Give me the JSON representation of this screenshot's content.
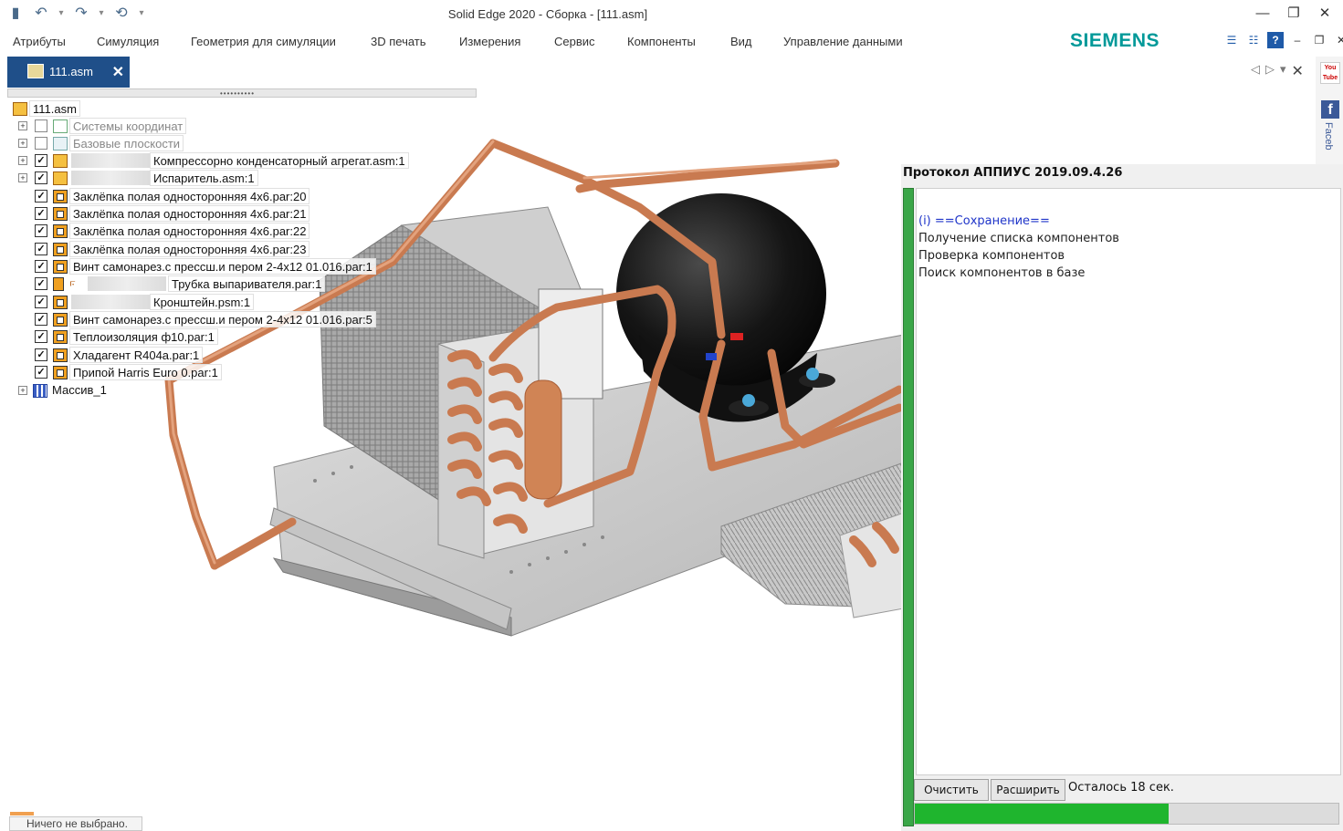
{
  "window": {
    "title": "Solid Edge 2020 - Сборка - [111.asm]",
    "brand": "SIEMENS"
  },
  "menu": [
    "Атрибуты",
    "Симуляция",
    "Геометрия для симуляции",
    "3D печать",
    "Измерения",
    "Сервис",
    "Компоненты",
    "Вид",
    "Управление данными"
  ],
  "doc_tab": {
    "label": "111.asm"
  },
  "tree": {
    "root": "111.asm",
    "items": [
      {
        "label": "Системы координат",
        "icon": "coordinate-system-icon"
      },
      {
        "label": "Базовые плоскости",
        "icon": "reference-plane-icon"
      },
      {
        "label": "Компрессорно конденсаторный агрегат.asm:1",
        "icon": "assembly-icon"
      },
      {
        "label": "Испаритель.asm:1",
        "icon": "assembly-icon"
      },
      {
        "label": "Заклёпка полая односторонняя 4х6.par:20",
        "icon": "part-icon"
      },
      {
        "label": "Заклёпка полая односторонняя 4х6.par:21",
        "icon": "part-icon"
      },
      {
        "label": "Заклёпка полая односторонняя 4х6.par:22",
        "icon": "part-icon"
      },
      {
        "label": "Заклёпка полая односторонняя 4х6.par:23",
        "icon": "part-icon"
      },
      {
        "label": "Винт самонарез.с прессш.и пером 2-4х12 01.016.par:1",
        "icon": "part-icon"
      },
      {
        "label": "Трубка выпаривателя.par:1",
        "icon": "tube-icon"
      },
      {
        "label": "Кронштейн.psm:1",
        "icon": "part-icon"
      },
      {
        "label": "Винт самонарез.с прессш.и пером 2-4х12 01.016.par:5",
        "icon": "part-icon"
      },
      {
        "label": "Теплоизоляция ф10.par:1",
        "icon": "part-icon"
      },
      {
        "label": "Хладагент R404a.par:1",
        "icon": "part-icon"
      },
      {
        "label": "Припой Harris Euro 0.par:1",
        "icon": "part-icon"
      },
      {
        "label": "Массив_1",
        "icon": "pattern-icon"
      }
    ]
  },
  "protocol": {
    "title": "Протокол АППИУС 2019.09.4.26",
    "lines": [
      "(i) ==Сохранение==",
      "Получение списка компонентов",
      "Проверка компонентов",
      "Поиск компонентов в базе"
    ],
    "clear_label": "Очистить",
    "expand_label": "Расширить",
    "remaining": "Осталось 18 сек.",
    "progress_fraction": 0.6
  },
  "social": {
    "youtube": "You Tube",
    "facebook": "Faceb"
  },
  "status": {
    "text": "Ничего не выбрано."
  },
  "colors": {
    "accent": "#1f4f89",
    "siemens": "#009999",
    "copper": "#c97a50",
    "progress": "#1fb52e"
  }
}
